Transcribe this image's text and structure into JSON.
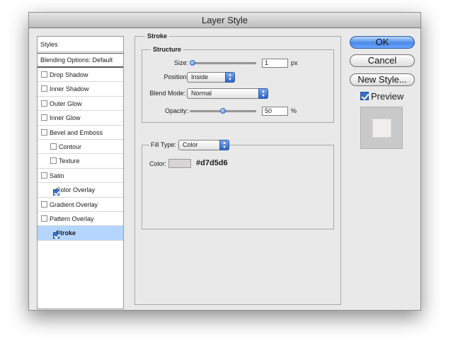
{
  "window": {
    "title": "Layer Style"
  },
  "styles_panel": {
    "header": "Styles",
    "blending_options": "Blending Options: Default",
    "items": [
      {
        "label": "Drop Shadow",
        "checked": false,
        "indent": false,
        "selected": false
      },
      {
        "label": "Inner Shadow",
        "checked": false,
        "indent": false,
        "selected": false
      },
      {
        "label": "Outer Glow",
        "checked": false,
        "indent": false,
        "selected": false
      },
      {
        "label": "Inner Glow",
        "checked": false,
        "indent": false,
        "selected": false
      },
      {
        "label": "Bevel and Emboss",
        "checked": false,
        "indent": false,
        "selected": false
      },
      {
        "label": "Contour",
        "checked": false,
        "indent": true,
        "selected": false
      },
      {
        "label": "Texture",
        "checked": false,
        "indent": true,
        "selected": false
      },
      {
        "label": "Satin",
        "checked": false,
        "indent": false,
        "selected": false
      },
      {
        "label": "Color Overlay",
        "checked": true,
        "indent": false,
        "selected": false
      },
      {
        "label": "Gradient Overlay",
        "checked": false,
        "indent": false,
        "selected": false
      },
      {
        "label": "Pattern Overlay",
        "checked": false,
        "indent": false,
        "selected": false
      },
      {
        "label": "Stroke",
        "checked": true,
        "indent": false,
        "selected": true
      }
    ]
  },
  "stroke": {
    "section_title": "Stroke",
    "structure_title": "Structure",
    "size": {
      "label": "Size:",
      "value": "1",
      "unit": "px",
      "slider_fraction": 0.01
    },
    "position": {
      "label": "Position:",
      "value": "Inside"
    },
    "blend_mode": {
      "label": "Blend Mode:",
      "value": "Normal"
    },
    "opacity": {
      "label": "Opacity:",
      "value": "50",
      "unit": "%",
      "slider_fraction": 0.5
    },
    "fill_type": {
      "label": "Fill Type:",
      "value": "Color"
    },
    "color": {
      "label": "Color:",
      "hex_text": "#d7d5d6",
      "swatch": "#d7d5d6"
    }
  },
  "buttons": {
    "ok": "OK",
    "cancel": "Cancel",
    "new_style": "New Style..."
  },
  "preview": {
    "label": "Preview",
    "checked": true
  }
}
